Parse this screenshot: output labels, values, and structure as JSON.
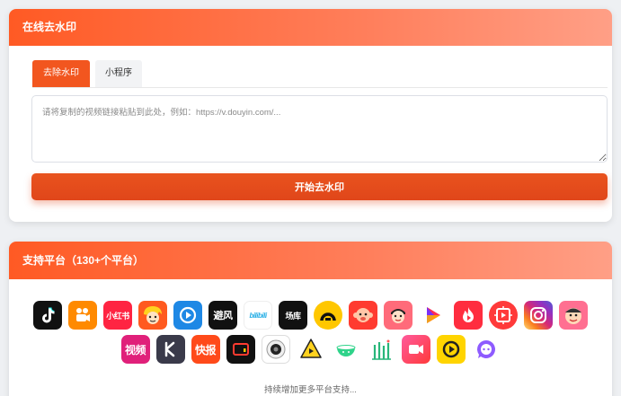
{
  "remover": {
    "title": "在线去水印",
    "tabs": [
      {
        "label": "去除水印",
        "active": true
      },
      {
        "label": "小程序",
        "active": false
      }
    ],
    "input": {
      "value": "",
      "placeholder": "请将复制的视频链接粘贴到此处，例如：https://v.douyin.com/..."
    },
    "submit_label": "开始去水印",
    "accent_color": "#f2561f"
  },
  "platforms": {
    "title": "支持平台（130+个平台）",
    "row1": [
      {
        "icon": "douyin-icon",
        "color": "#111111"
      },
      {
        "icon": "kuaishou-icon",
        "color": "#ff8a00"
      },
      {
        "icon": "xiaohongshu-icon",
        "color": "#ff2442",
        "text": "小红书"
      },
      {
        "icon": "manga-face-icon",
        "color": "#ff5a1f"
      },
      {
        "icon": "play-circle-icon",
        "color": "#1e88e5"
      },
      {
        "icon": "bifeng-icon",
        "color": "#111111",
        "text": "避风"
      },
      {
        "icon": "bilibili-icon",
        "color": "#ffffff",
        "text": "bilibili"
      },
      {
        "icon": "changku-icon",
        "color": "#111111",
        "text": "场库"
      },
      {
        "icon": "a-logo-icon",
        "color": "#ffc700"
      },
      {
        "icon": "monkey-face-icon",
        "color": "#ff3b30"
      },
      {
        "icon": "cartoon-face-icon",
        "color": "#ff6b7a"
      },
      {
        "icon": "triangle-play-icon",
        "color": "#ffffff"
      },
      {
        "icon": "flame-icon",
        "color": "#ff2d3f"
      },
      {
        "icon": "circle-frame-icon",
        "color": "#ff3a3a"
      },
      {
        "icon": "instagram-icon",
        "color": "#c13584"
      },
      {
        "icon": "pipixia-icon",
        "color": "#ff6f91"
      }
    ],
    "row2": [
      {
        "icon": "shipin-icon",
        "color": "#e0207a",
        "text": "视频"
      },
      {
        "icon": "k-logo-icon",
        "color": "#3a3a4a"
      },
      {
        "icon": "kuaibao-icon",
        "color": "#ff4a1a",
        "text": "快报"
      },
      {
        "icon": "video-frame-icon",
        "color": "#111111"
      },
      {
        "icon": "camera-lens-icon",
        "color": "#ffffff"
      },
      {
        "icon": "yellow-play-icon",
        "color": "#ffffff"
      },
      {
        "icon": "bowl-icon",
        "color": "#ffffff"
      },
      {
        "icon": "bamboo-icon",
        "color": "#ffffff"
      },
      {
        "icon": "camera-icon",
        "color": "#ff3a6e"
      },
      {
        "icon": "round-play-icon",
        "color": "#ffd400"
      },
      {
        "icon": "chat-bubble-icon",
        "color": "#ffffff"
      }
    ],
    "more_text": "持续增加更多平台支持..."
  }
}
